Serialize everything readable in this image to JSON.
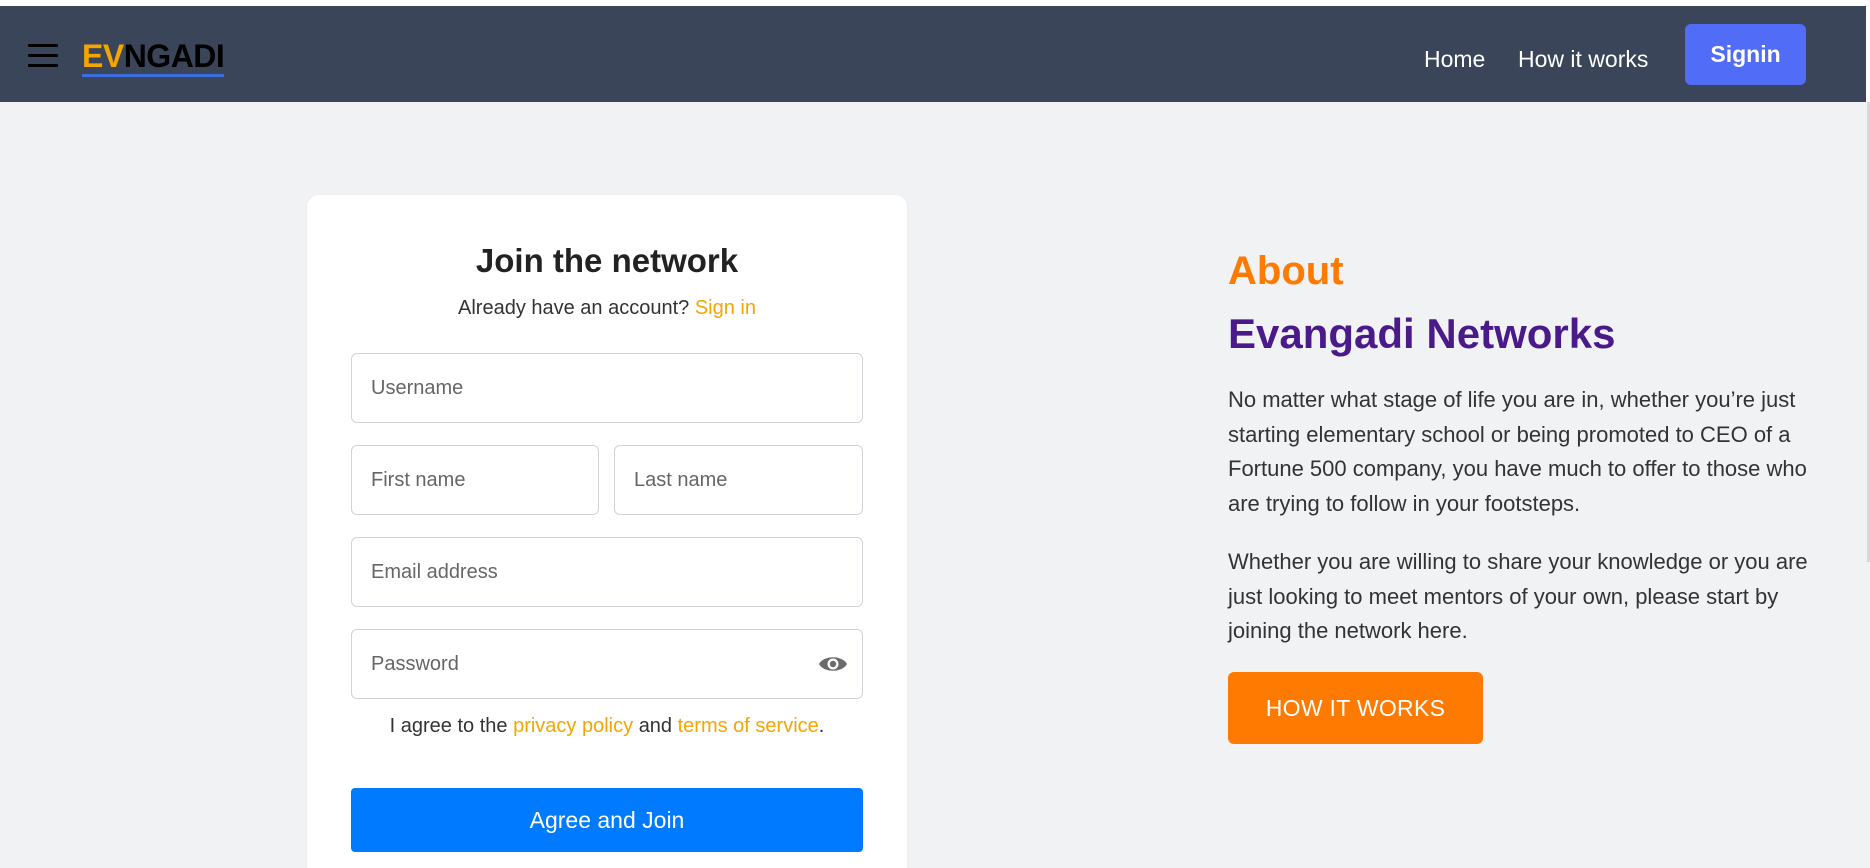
{
  "header": {
    "logo_ev": "EV",
    "logo_rest": "NGADI",
    "nav": {
      "home": "Home",
      "how_it_works": "How it works"
    },
    "signin_label": "Signin"
  },
  "signup": {
    "title": "Join the network",
    "already_text": "Already have an account?",
    "signin_link": "Sign in",
    "placeholders": {
      "username": "Username",
      "first_name": "First name",
      "last_name": "Last name",
      "email": "Email address",
      "password": "Password"
    },
    "agree_prefix": "I agree to the",
    "privacy_link": "privacy policy",
    "agree_and": "and",
    "terms_link": "terms of service",
    "agree_suffix": ".",
    "join_label": "Agree and Join"
  },
  "about": {
    "label": "About",
    "title": "Evangadi Networks",
    "paragraph1": "No matter what stage of life you are in, whether you’re just starting elementary school or being promoted to CEO of a Fortune 500 company, you have much to offer to those who are trying to follow in your footsteps.",
    "paragraph2": "Whether you are willing to share your knowledge or you are just looking to meet mentors of your own, please start by joining the network here.",
    "how_button": "HOW IT WORKS"
  },
  "colors": {
    "header_bg": "#3a4559",
    "accent_orange": "#ff7a00",
    "link_orange": "#f5a500",
    "title_purple": "#4b1a8a",
    "primary_blue": "#007bff",
    "signin_blue": "#516cf6"
  },
  "icons": {
    "menu": "hamburger-icon",
    "password_toggle": "eye-icon"
  }
}
